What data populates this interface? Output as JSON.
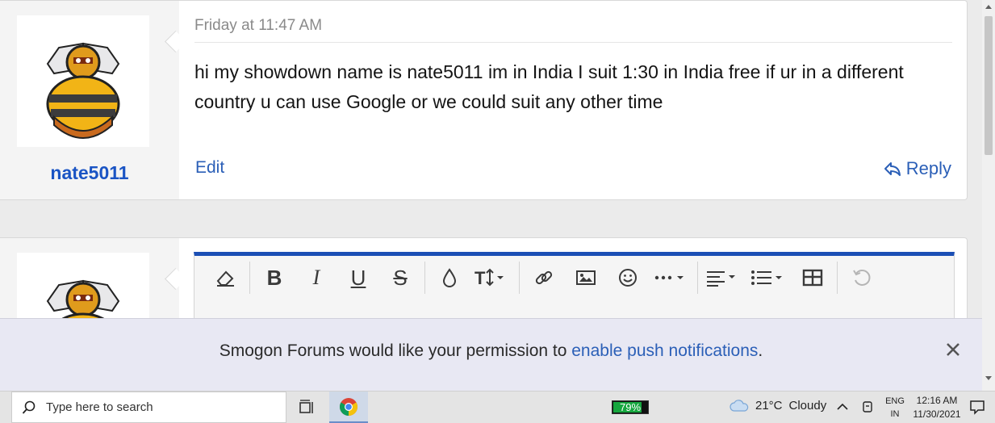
{
  "posts": [
    {
      "username": "nate5011",
      "date": "Friday at 11:47 AM",
      "message": "hi my showdown name is nate5011 im in India I suit 1:30 in India free if ur in a different country u can use Google or we could suit any other time",
      "edit_label": "Edit",
      "reply_label": "Reply"
    }
  ],
  "editor": {
    "toolbar": [
      {
        "name": "eraser-icon",
        "glyph": "⌫"
      },
      {
        "name": "bold-button",
        "glyph": "B"
      },
      {
        "name": "italic-button",
        "glyph": "I"
      },
      {
        "name": "underline-button",
        "glyph": "U"
      },
      {
        "name": "strikethrough-button",
        "glyph": "S"
      },
      {
        "name": "color-icon",
        "glyph": "❒"
      },
      {
        "name": "font-size-icon",
        "glyph": "T↕"
      },
      {
        "name": "link-icon",
        "glyph": "🔗"
      },
      {
        "name": "image-icon",
        "glyph": "▨"
      },
      {
        "name": "emoji-icon",
        "glyph": "☺"
      },
      {
        "name": "more-icon",
        "glyph": "⋯"
      },
      {
        "name": "align-icon",
        "glyph": "≡"
      },
      {
        "name": "list-icon",
        "glyph": "☰"
      },
      {
        "name": "table-icon",
        "glyph": "⊞"
      },
      {
        "name": "undo-icon",
        "glyph": "↺"
      }
    ]
  },
  "banner": {
    "text_before": "Smogon Forums would like your permission to ",
    "link_text": "enable push notifications",
    "text_after": "."
  },
  "taskbar": {
    "search_placeholder": "Type here to search",
    "battery_label": "79%",
    "battery_level": 0.79,
    "weather_temp": "21°C",
    "weather_desc": "Cloudy",
    "lang_top": "ENG",
    "lang_bottom": "IN",
    "time": "12:16 AM",
    "date": "11/30/2021"
  },
  "colors": {
    "link": "#2b5fb7",
    "username": "#1a54c4",
    "editor_accent": "#1b4fb5",
    "battery_green": "#16a63e"
  }
}
